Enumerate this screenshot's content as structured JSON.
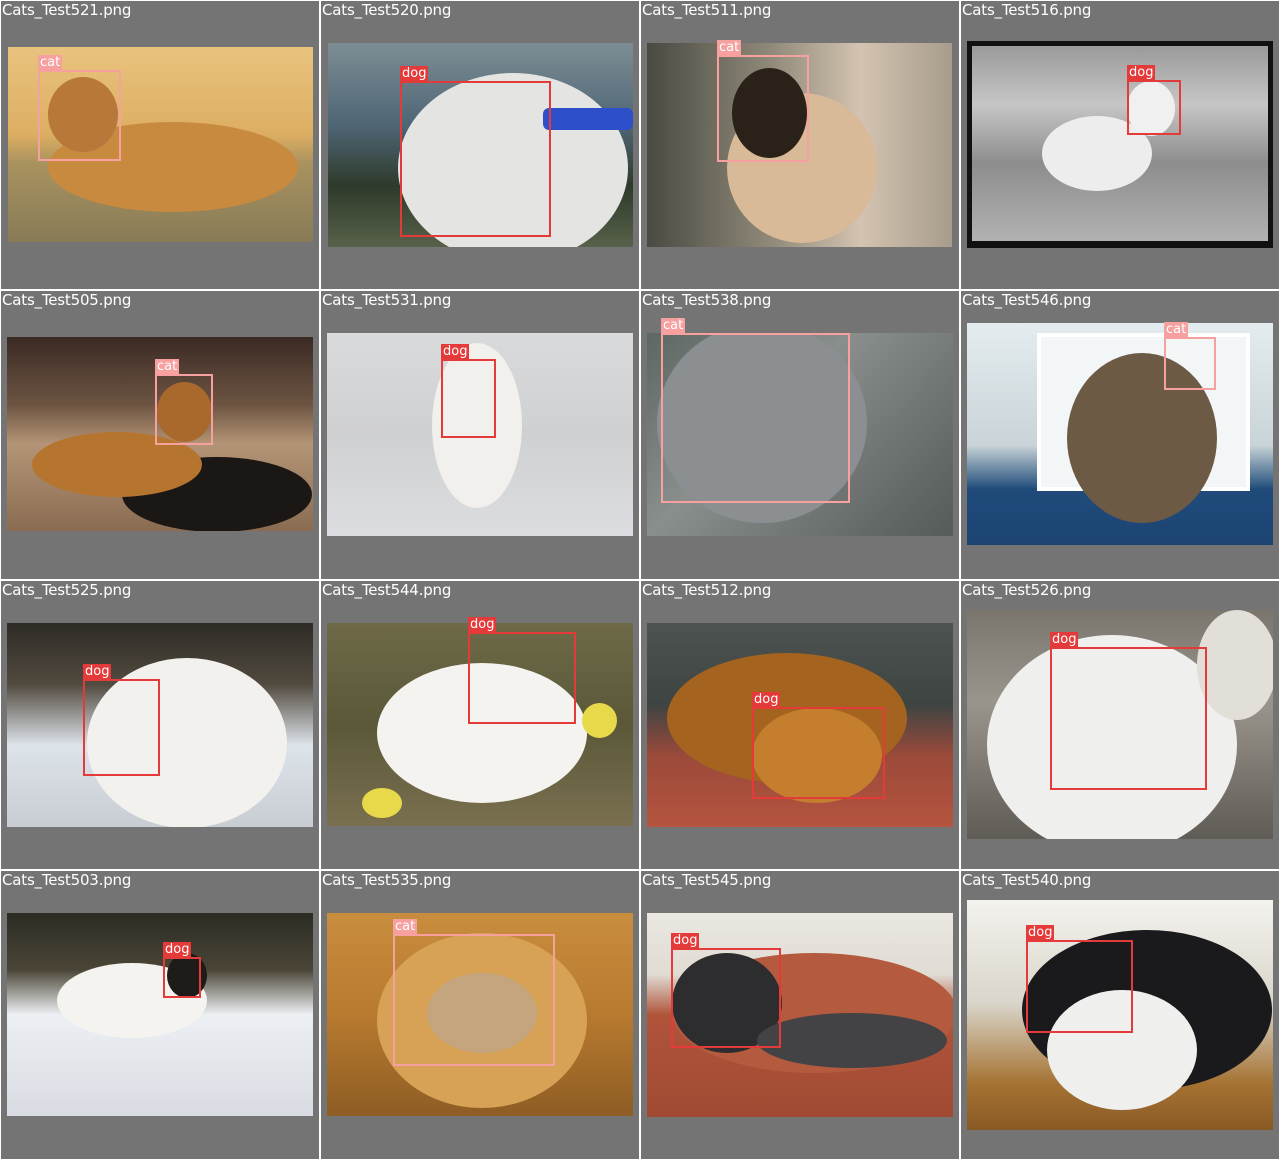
{
  "colors": {
    "cell_background": "#747474",
    "grid_lines": "#ffffff",
    "dog_box": "#e53a3a",
    "cat_box": "#f6a0a0",
    "label_text": "#ffffff"
  },
  "tiles": [
    {
      "filename": "Cats_Test521.png",
      "label": "cat"
    },
    {
      "filename": "Cats_Test520.png",
      "label": "dog"
    },
    {
      "filename": "Cats_Test511.png",
      "label": "cat"
    },
    {
      "filename": "Cats_Test516.png",
      "label": "dog"
    },
    {
      "filename": "Cats_Test505.png",
      "label": "cat"
    },
    {
      "filename": "Cats_Test531.png",
      "label": "dog"
    },
    {
      "filename": "Cats_Test538.png",
      "label": "cat"
    },
    {
      "filename": "Cats_Test546.png",
      "label": "cat"
    },
    {
      "filename": "Cats_Test525.png",
      "label": "dog"
    },
    {
      "filename": "Cats_Test544.png",
      "label": "dog"
    },
    {
      "filename": "Cats_Test512.png",
      "label": "dog"
    },
    {
      "filename": "Cats_Test526.png",
      "label": "dog"
    },
    {
      "filename": "Cats_Test503.png",
      "label": "dog"
    },
    {
      "filename": "Cats_Test535.png",
      "label": "cat"
    },
    {
      "filename": "Cats_Test545.png",
      "label": "dog"
    },
    {
      "filename": "Cats_Test540.png",
      "label": "dog"
    }
  ]
}
